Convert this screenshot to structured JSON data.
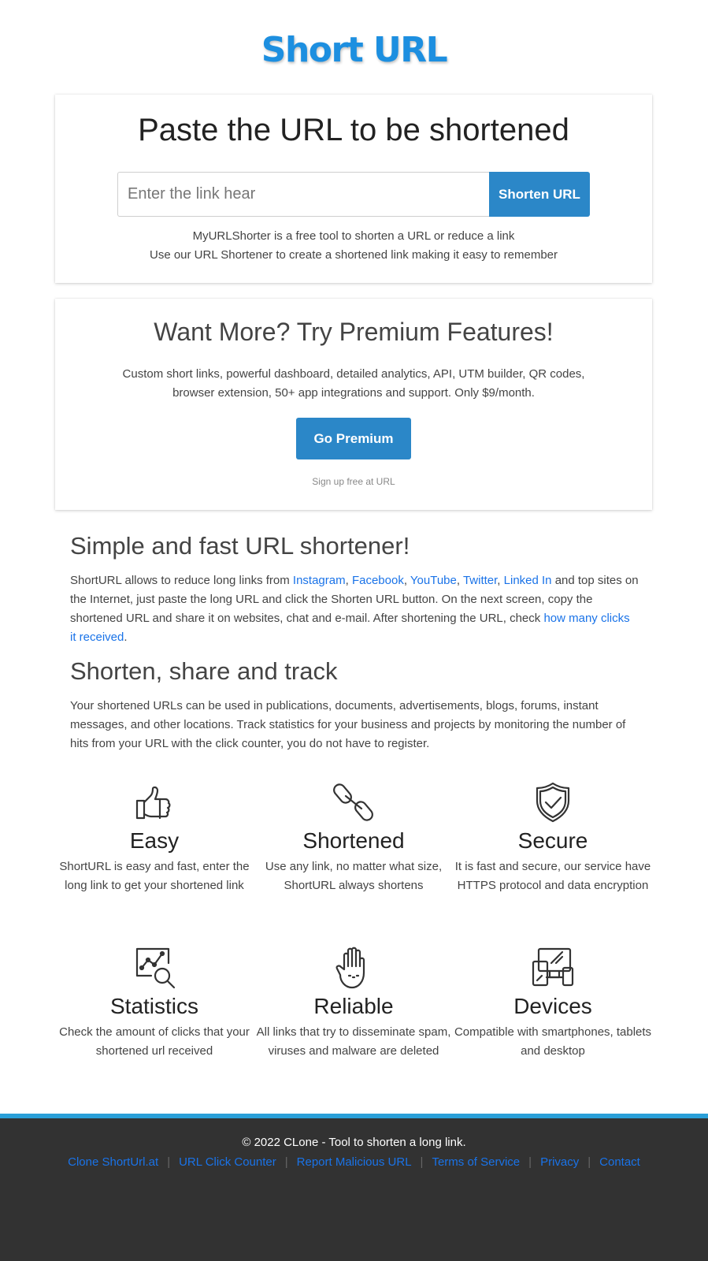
{
  "logo": {
    "text": "Short URL"
  },
  "shorten": {
    "title": "Paste the URL to be shortened",
    "input_placeholder": "Enter the link hear",
    "input_value": "",
    "button_label": "Shorten URL",
    "desc_line1": "MyURLShorter is a free tool to shorten a URL or reduce a link",
    "desc_line2": "Use our URL Shortener to create a shortened link making it easy to remember"
  },
  "premium": {
    "title": "Want More? Try Premium Features!",
    "desc": "Custom short links, powerful dashboard, detailed analytics, API, UTM builder, QR codes, browser extension, 50+ app integrations and support. Only $9/month.",
    "button_label": "Go Premium",
    "signup_text": "Sign up free at URL"
  },
  "article1": {
    "title": "Simple and fast URL shortener!",
    "text_start": "ShortURL allows to reduce long links from ",
    "links": [
      "Instagram",
      "Facebook",
      "YouTube",
      "Twitter",
      "Linked In"
    ],
    "sep": ", ",
    "text_mid": " and top sites on the Internet, just paste the long URL and click the Shorten URL button. On the next screen, copy the shortened URL and share it on websites, chat and e-mail. After shortening the URL, check ",
    "link_clicks": "how many clicks it received",
    "text_end": "."
  },
  "article2": {
    "title": "Shorten, share and track",
    "text": "Your shortened URLs can be used in publications, documents, advertisements, blogs, forums, instant messages, and other locations. Track statistics for your business and projects by monitoring the number of hits from your URL with the click counter, you do not have to register."
  },
  "features": [
    {
      "icon": "thumbs-up-icon",
      "title": "Easy",
      "desc": "ShortURL is easy and fast, enter the long link to get your shortened link"
    },
    {
      "icon": "chain-link-icon",
      "title": "Shortened",
      "desc": "Use any link, no matter what size, ShortURL always shortens"
    },
    {
      "icon": "shield-check-icon",
      "title": "Secure",
      "desc": "It is fast and secure, our service have HTTPS protocol and data encryption"
    },
    {
      "icon": "statistics-icon",
      "title": "Statistics",
      "desc": "Check the amount of clicks that your shortened url received"
    },
    {
      "icon": "raised-hand-icon",
      "title": "Reliable",
      "desc": "All links that try to disseminate spam, viruses and malware are deleted"
    },
    {
      "icon": "devices-icon",
      "title": "Devices",
      "desc": "Compatible with smartphones, tablets and desktop"
    }
  ],
  "footer": {
    "copyright": "© 2022 CLone - Tool to shorten a long link.",
    "links": [
      "Clone ShortUrl.at",
      "URL Click Counter",
      "Report Malicious URL",
      "Terms of Service",
      "Privacy",
      "Contact"
    ],
    "separator": "|"
  },
  "colors": {
    "brand": "#1d8fe0",
    "button": "#2b87c8",
    "link": "#1a73e8",
    "footer_bg": "#323232",
    "footer_accent": "#2a9fd8"
  }
}
